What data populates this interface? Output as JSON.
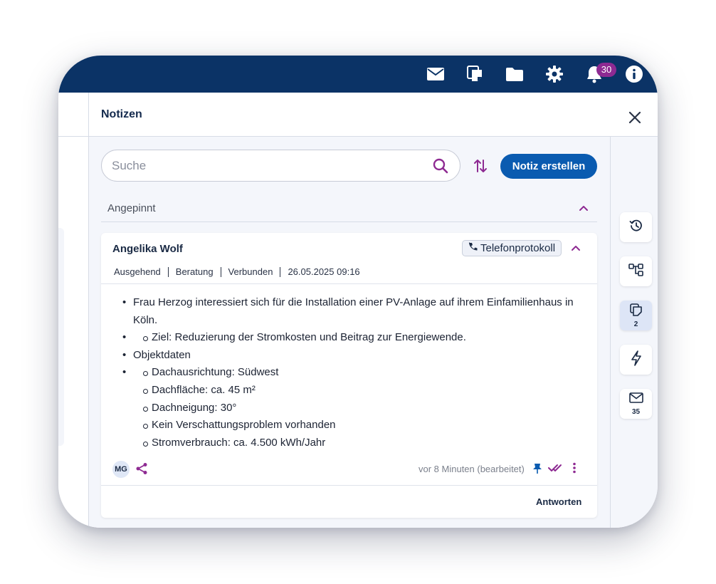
{
  "topbar": {
    "icons": [
      "mail-icon",
      "notes-icon",
      "folder-icon",
      "gear-icon",
      "bell-icon",
      "info-icon"
    ],
    "notifications_count": "30",
    "background_color": "#0b3366",
    "badge_color": "#8e2a92"
  },
  "panel": {
    "title": "Notizen",
    "search_placeholder": "Suche",
    "create_label": "Notiz erstellen",
    "accent_color": "#0a5bb0",
    "section_label": "Angepinnt"
  },
  "note": {
    "author": "Angelika Wolf",
    "tag": "Telefonprotokoll",
    "meta": [
      "Ausgehend",
      "Beratung",
      "Verbunden",
      "26.05.2025 09:16"
    ],
    "body": {
      "p1_line1": "Frau Herzog interessiert sich für die Installation einer PV-Anlage auf ihrem Einfamilienhaus in",
      "p1_line2": "Köln.",
      "goal": "Ziel: Reduzierung der Stromkosten und Beitrag zur Energiewende.",
      "objects_heading": "Objektdaten",
      "objects": [
        "Dachausrichtung: Südwest",
        "Dachfläche: ca. 45 m²",
        "Dachneigung: 30°",
        "Kein Verschattungsproblem vorhanden",
        "Stromverbrauch: ca. 4.500 kWh/Jahr"
      ]
    },
    "avatar_initials": "MG",
    "timestamp": "vor 8 Minuten (bearbeitet)",
    "reply_label": "Antworten",
    "purple_color": "#8e2a92"
  },
  "rightbar": {
    "items": [
      {
        "icon": "history-icon",
        "count": ""
      },
      {
        "icon": "hierarchy-icon",
        "count": ""
      },
      {
        "icon": "notes-icon",
        "count": "2"
      },
      {
        "icon": "lightning-icon",
        "count": ""
      },
      {
        "icon": "mail-icon",
        "count": "35"
      }
    ]
  }
}
